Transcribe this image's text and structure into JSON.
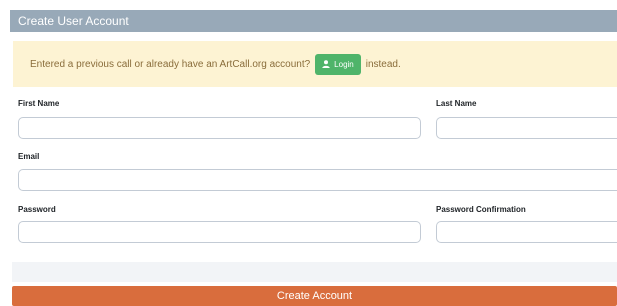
{
  "panel": {
    "title": "Create User Account"
  },
  "alert": {
    "text_before": "Entered a previous call or already have an ArtCall.org account?",
    "login_label": "Login",
    "text_after": "instead."
  },
  "form": {
    "first_name": {
      "label": "First Name",
      "value": ""
    },
    "last_name": {
      "label": "Last Name",
      "value": ""
    },
    "email": {
      "label": "Email",
      "value": ""
    },
    "password": {
      "label": "Password",
      "value": ""
    },
    "password_confirmation": {
      "label": "Password Confirmation",
      "value": ""
    }
  },
  "submit": {
    "label": "Create Account"
  },
  "colors": {
    "header_bg": "#98a9b8",
    "alert_bg": "#fdf3d3",
    "login_button": "#4fb46a",
    "submit_button": "#d96d3d"
  },
  "icons": {
    "login": "user-icon"
  }
}
